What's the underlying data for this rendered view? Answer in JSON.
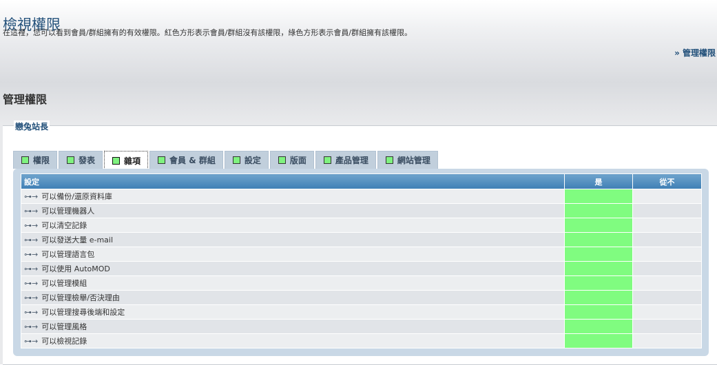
{
  "header": {
    "title": "檢視權限",
    "description": "在這裡，您可以看到會員/群組擁有的有效權限。紅色方形表示會員/群組沒有該權限，綠色方形表示會員/群組擁有該權限。",
    "nav_link": "» 管理權限"
  },
  "section_title": "管理權限",
  "group_name": "戀兔站長",
  "tabs": [
    {
      "label": "權限",
      "active": false
    },
    {
      "label": "發表",
      "active": false
    },
    {
      "label": "雜項",
      "active": true
    },
    {
      "label": "會員 & 群組",
      "active": false
    },
    {
      "label": "設定",
      "active": false
    },
    {
      "label": "版面",
      "active": false
    },
    {
      "label": "產品管理",
      "active": false
    },
    {
      "label": "網站管理",
      "active": false
    }
  ],
  "table": {
    "headers": {
      "setting": "設定",
      "yes": "是",
      "never": "從不"
    },
    "rows": [
      {
        "label": "可以備份/還原資料庫",
        "value": "yes"
      },
      {
        "label": "可以管理機器人",
        "value": "yes"
      },
      {
        "label": "可以清空記錄",
        "value": "yes"
      },
      {
        "label": "可以發送大量 e-mail",
        "value": "yes"
      },
      {
        "label": "可以管理語言包",
        "value": "yes"
      },
      {
        "label": "可以使用 AutoMOD",
        "value": "yes"
      },
      {
        "label": "可以管理模組",
        "value": "yes"
      },
      {
        "label": "可以管理檢舉/否決理由",
        "value": "yes"
      },
      {
        "label": "可以管理搜尋後端和設定",
        "value": "yes"
      },
      {
        "label": "可以管理風格",
        "value": "yes"
      },
      {
        "label": "可以檢視記錄",
        "value": "yes"
      }
    ]
  },
  "colors": {
    "granted": "#80fc80",
    "accent": "#22507a"
  },
  "icons": {
    "row_icon": "arrow-key-icon",
    "tab_marker": "green-square-icon"
  }
}
